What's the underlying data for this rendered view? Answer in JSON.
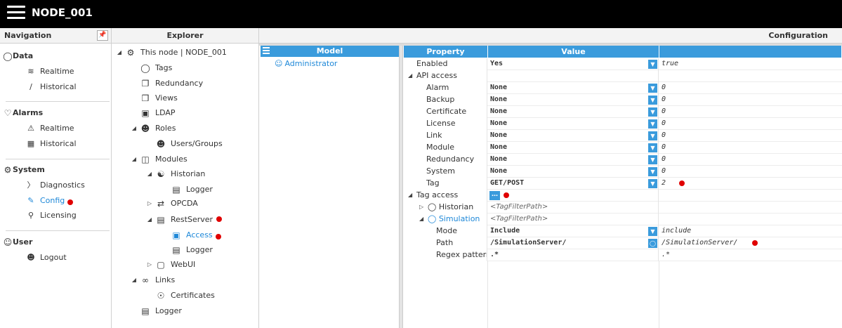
{
  "app": {
    "title": "NODE_001"
  },
  "nav": {
    "header": "Navigation",
    "groups": [
      {
        "title": "Data",
        "items": [
          {
            "label": "Realtime"
          },
          {
            "label": "Historical"
          }
        ]
      },
      {
        "title": "Alarms",
        "items": [
          {
            "label": "Realtime"
          },
          {
            "label": "Historical"
          }
        ]
      },
      {
        "title": "System",
        "items": [
          {
            "label": "Diagnostics"
          },
          {
            "label": "Config"
          },
          {
            "label": "Licensing"
          }
        ]
      },
      {
        "title": "User",
        "items": [
          {
            "label": "Logout"
          }
        ]
      }
    ]
  },
  "explorer": {
    "header": "Explorer",
    "nodes": [
      {
        "label": "This node | NODE_001"
      },
      {
        "label": "Tags"
      },
      {
        "label": "Redundancy"
      },
      {
        "label": "Views"
      },
      {
        "label": "LDAP"
      },
      {
        "label": "Roles"
      },
      {
        "label": "Users/Groups"
      },
      {
        "label": "Modules"
      },
      {
        "label": "Historian"
      },
      {
        "label": "Logger"
      },
      {
        "label": "OPCDA"
      },
      {
        "label": "RestServer"
      },
      {
        "label": "Access"
      },
      {
        "label": "Logger"
      },
      {
        "label": "WebUI"
      },
      {
        "label": "Links"
      },
      {
        "label": "Certificates"
      },
      {
        "label": "Logger"
      }
    ]
  },
  "config": {
    "header": "Configuration",
    "model": {
      "header": "Model",
      "user": "Administrator"
    },
    "grid": {
      "columns": {
        "property": "Property",
        "value": "Value",
        "default": ""
      },
      "rows": [
        {
          "property": "Enabled",
          "value": "Yes",
          "default": "true"
        },
        {
          "property": "API access",
          "value": "",
          "default": ""
        },
        {
          "property": "Alarm",
          "value": "None",
          "default": "0"
        },
        {
          "property": "Backup",
          "value": "None",
          "default": "0"
        },
        {
          "property": "Certificate",
          "value": "None",
          "default": "0"
        },
        {
          "property": "License",
          "value": "None",
          "default": "0"
        },
        {
          "property": "Link",
          "value": "None",
          "default": "0"
        },
        {
          "property": "Module",
          "value": "None",
          "default": "0"
        },
        {
          "property": "Redundancy",
          "value": "None",
          "default": "0"
        },
        {
          "property": "System",
          "value": "None",
          "default": "0"
        },
        {
          "property": "Tag",
          "value": "GET/POST",
          "default": "2"
        },
        {
          "property": "Tag access",
          "value": "",
          "default": ""
        },
        {
          "property": "Historian",
          "value": "<TagFilterPath>",
          "default": ""
        },
        {
          "property": "Simulation",
          "value": "<TagFilterPath>",
          "default": ""
        },
        {
          "property": "Mode",
          "value": "Include",
          "default": "include"
        },
        {
          "property": "Path",
          "value": "/SimulationServer/",
          "default": "/SimulationServer/"
        },
        {
          "property": "Regex pattern",
          "value": ".*",
          "default": ".*"
        }
      ]
    }
  },
  "colors": {
    "accent": "#3a9bdc",
    "link": "#1e88d8",
    "marker": "#e00000",
    "topbar": "#000000"
  }
}
